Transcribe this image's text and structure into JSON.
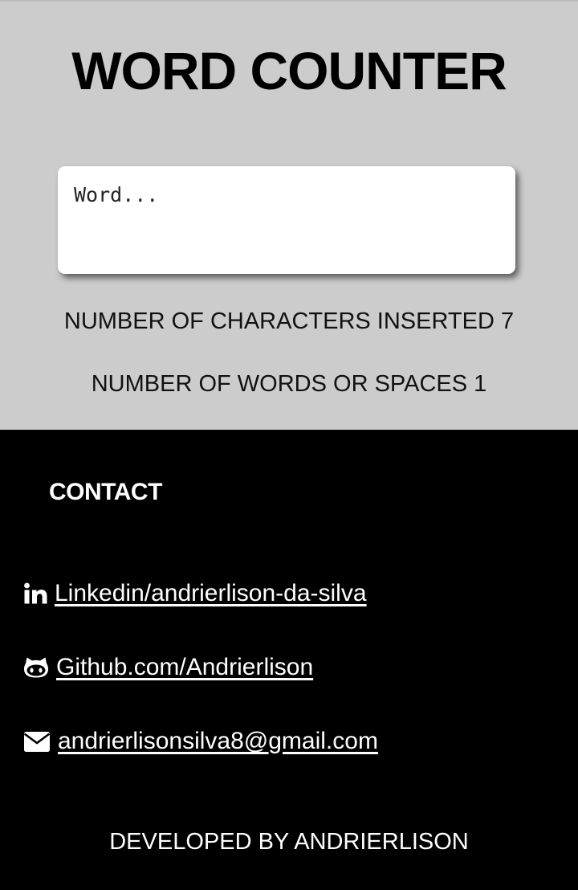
{
  "header": {
    "title": "WORD COUNTER"
  },
  "input": {
    "placeholder": "Word...",
    "value": ""
  },
  "stats": {
    "characters_label": "NUMBER OF CHARACTERS INSERTED 7",
    "words_label": "NUMBER OF WORDS OR SPACES 1"
  },
  "footer": {
    "contact_title": "CONTACT",
    "links": [
      {
        "icon": "linkedin-icon",
        "text": "Linkedin/andrierlison-da-silva"
      },
      {
        "icon": "github-icon",
        "text": "Github.com/Andrierlison"
      },
      {
        "icon": "envelope-icon",
        "text": "andrierlisonsilva8@gmail.com"
      }
    ],
    "credit": "DEVELOPED BY ANDRIERLISON"
  },
  "colors": {
    "top_background": "#cccccc",
    "footer_background": "#000000",
    "text_dark": "#000000",
    "text_light": "#ffffff"
  }
}
